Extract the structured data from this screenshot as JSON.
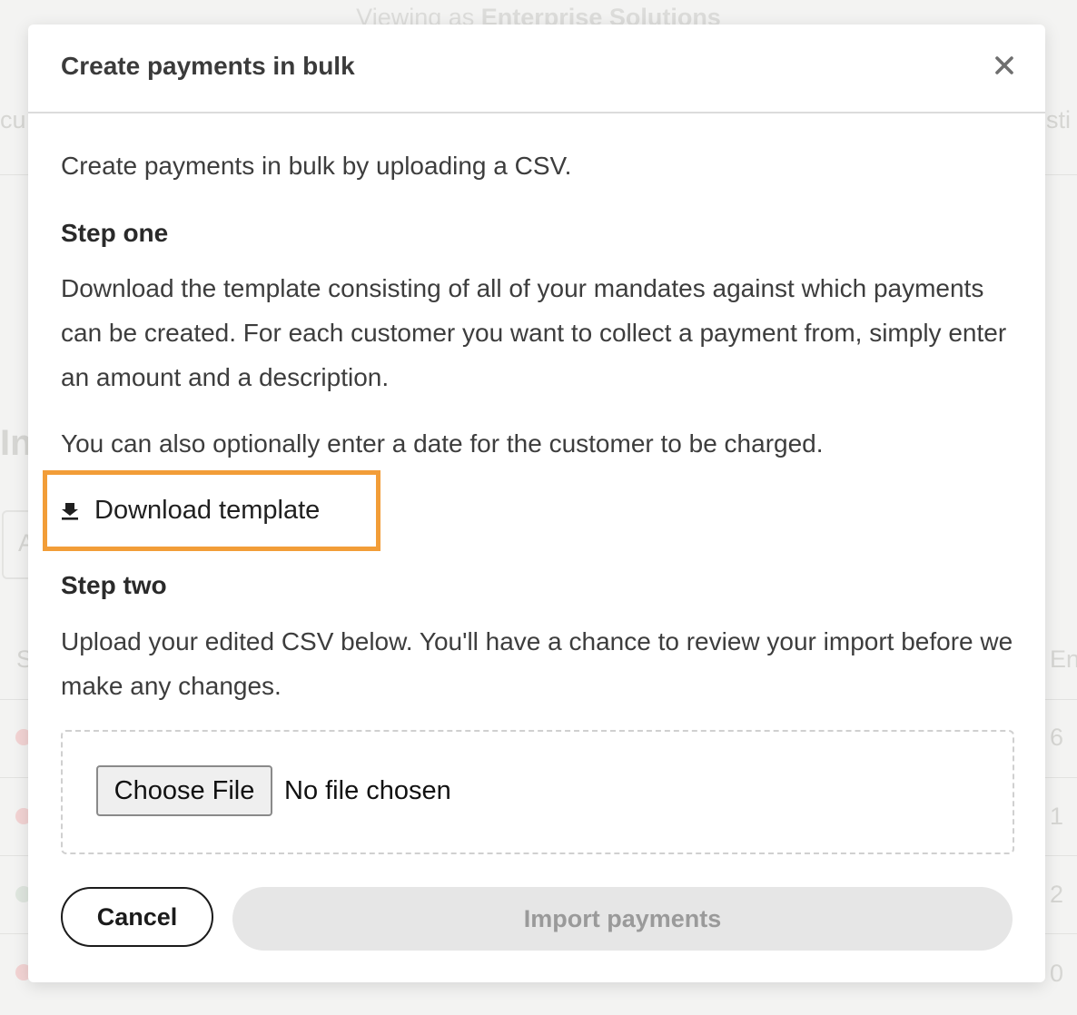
{
  "background": {
    "viewing_prefix": "Viewing as",
    "viewing_org": "Enterprise Solutions",
    "fragments": {
      "left_top": "cu",
      "right_top": "sti",
      "left_heading": "In",
      "left_input": "A",
      "left_col": "S",
      "right_col": "En",
      "right_row1": "6",
      "right_row2": "1",
      "right_row3": "2",
      "right_row4": "0"
    }
  },
  "modal": {
    "title": "Create payments in bulk",
    "close_label": "×",
    "intro": "Create payments in bulk by uploading a CSV.",
    "step_one": {
      "heading": "Step one",
      "paragraph": "Download the template consisting of all of your mandates against which payments can be created. For each customer you want to collect a payment from, simply enter an amount and a description.",
      "note": "You can also optionally enter a date for the customer to be charged.",
      "download_label": "Download template"
    },
    "step_two": {
      "heading": "Step two",
      "paragraph": "Upload your edited CSV below. You'll have a chance to review your import before we make any changes.",
      "file_button_label": "Choose File",
      "file_status": "No file chosen"
    },
    "actions": {
      "cancel_label": "Cancel",
      "import_label": "Import payments"
    }
  },
  "colors": {
    "highlight": "#f29d38",
    "disabled_button_bg": "#e6e6e6",
    "disabled_button_text": "#9a9a9a"
  },
  "icons": {
    "close": "close-icon",
    "download": "download-icon"
  }
}
